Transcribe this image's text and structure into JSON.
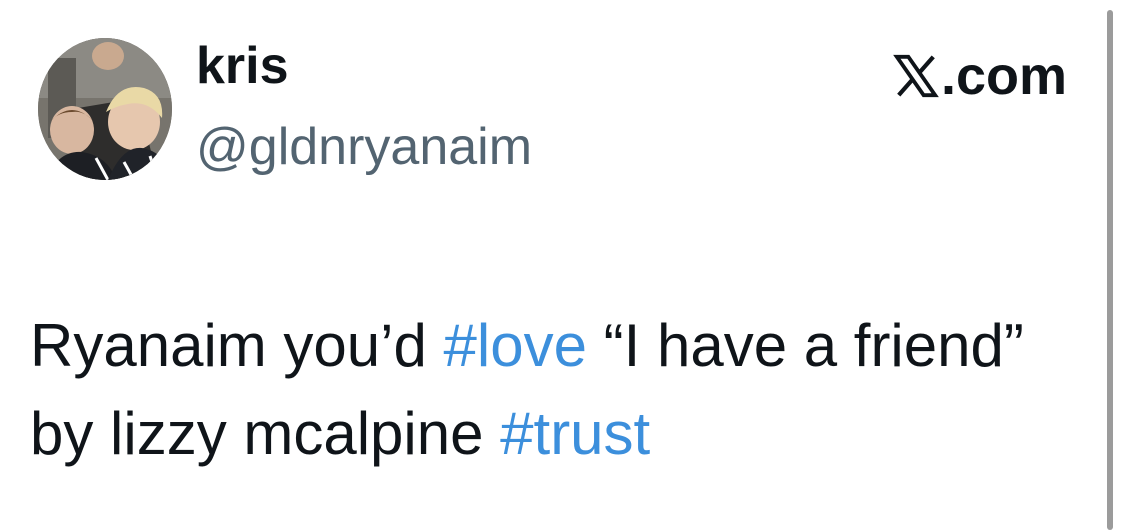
{
  "tweet": {
    "author": {
      "display_name": "kris",
      "handle": "@gldnryanaim"
    },
    "source": {
      "logo_icon": "x-logo-icon",
      "domain": ".com"
    },
    "text_segments": [
      {
        "text": "Ryanaim you’d ",
        "type": "text"
      },
      {
        "text": "#love",
        "type": "hashtag"
      },
      {
        "text": " “I have a friend” by lizzy mcalpine ",
        "type": "text"
      },
      {
        "text": "#trust",
        "type": "hashtag"
      }
    ]
  },
  "colors": {
    "text": "#0f1419",
    "handle": "#536471",
    "hashtag": "#3c8fdc",
    "background": "#ffffff"
  }
}
